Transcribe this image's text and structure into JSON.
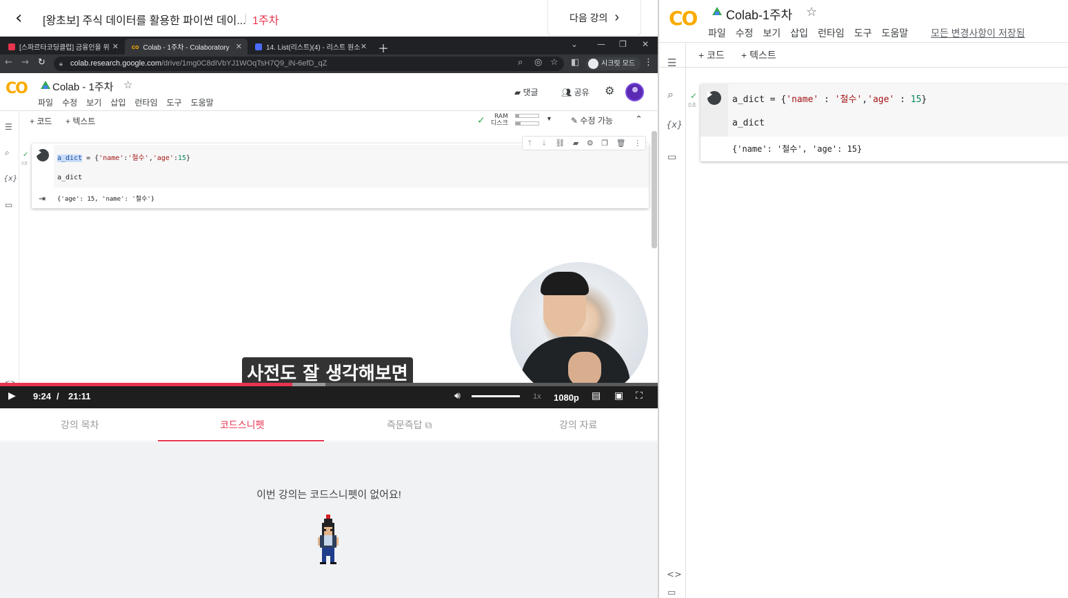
{
  "lecture": {
    "back_icon": "chevron-left-icon",
    "title": "[왕초보] 주식 데이터를 활용한 파이썬 데이...",
    "week": "1주차",
    "next_button": "다음 강의"
  },
  "browser": {
    "tabs": [
      {
        "label": "[스파르타코딩클럽] 금융인을 위",
        "favicon_color": "#e8344e"
      },
      {
        "label": "Colab - 1주차 - Colaboratory",
        "favicon_color": "#f9ab00"
      },
      {
        "label": "14. List(리스트)(4) - 리스트 원소",
        "favicon_color": "#4a6cf7"
      }
    ],
    "url_host": "colab.research.google.com",
    "url_path": "/drive/1mg0C8dIVbYJ1WOqTsH7Q9_iN-6efD_qZ",
    "secret_mode": "시크릿 모드"
  },
  "colab_embedded": {
    "logo": "CO",
    "title": "Colab - 1주차",
    "menu": [
      "파일",
      "수정",
      "보기",
      "삽입",
      "런타임",
      "도구",
      "도움말"
    ],
    "comment_label": "댓글",
    "share_label": "공유",
    "add_code": "+ 코드",
    "add_text": "+ 텍스트",
    "ram_label": "RAM",
    "disk_label": "디스크",
    "ram_usage": 0.15,
    "disk_usage": 0.2,
    "edit_mode": "수정 가능",
    "exec_time": "0초",
    "code_var": "a_dict",
    "code_rest_1": " = {",
    "code_k1": "'name'",
    "code_colon": ":",
    "code_v1": "'철수'",
    "code_comma": ",",
    "code_k2": "'age'",
    "code_v2": "15",
    "code_close": "}",
    "code_line2": "a_dict",
    "output": "{'age': 15, 'name': '철수'}"
  },
  "video": {
    "subtitle": "사전도 잘 생각해보면",
    "current_time": "9:24",
    "time_sep": "/",
    "duration": "21:11",
    "speed": "1x",
    "quality": "1080p",
    "played_fraction": 0.444,
    "buffered_fraction": 0.495,
    "volume": 1.0
  },
  "lecture_tabs": [
    {
      "label": "강의 목차"
    },
    {
      "label": "코드스니펫",
      "active": true
    },
    {
      "label": "즉문즉답"
    },
    {
      "label": "강의 자료"
    }
  ],
  "snippet_empty_message": "이번 강의는 코드스니펫이 없어요!",
  "colab_right": {
    "logo": "CO",
    "title": "Colab-1주차",
    "menu": [
      "파일",
      "수정",
      "보기",
      "삽입",
      "런타임",
      "도구",
      "도움말"
    ],
    "saved_status": "모든 변경사항이 저장됨",
    "add_code": "+ 코드",
    "add_text": "+ 텍스트",
    "exec_time": "0초",
    "code_var": "a_dict",
    "code_eq": " = {",
    "code_k1": "'name'",
    "code_colon1": " : ",
    "code_v1": "'철수'",
    "code_comma": ",",
    "code_k2": "'age'",
    "code_colon2": " : ",
    "code_v2": "15",
    "code_close": "}",
    "code_line2": "a_dict",
    "output": "{'name': '철수', 'age': 15}"
  }
}
